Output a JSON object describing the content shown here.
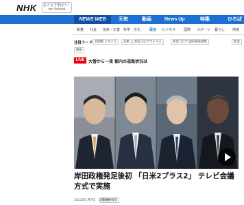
{
  "header": {
    "logo": "NHK",
    "home_link": {
      "line1": "おうちで学ぼう！",
      "line2": "for School"
    }
  },
  "nav": {
    "items": [
      "NEWS WEB",
      "天気",
      "動画",
      "News Up",
      "特集",
      "ひろば"
    ],
    "colors": {
      "bar": "#1d6fd1",
      "brand": "#1250a8"
    }
  },
  "categories": [
    "新着",
    "社会",
    "気象・災害",
    "科学・文化",
    "政治",
    "ビジネス",
    "国際",
    "スポーツ",
    "暮らし",
    "地域"
  ],
  "active_category": "政治",
  "keywords": {
    "label": "注目ワード",
    "row1": [
      "北朝鮮 ミサイル",
      "気象",
      "新型コロナウイルス",
      "新型コロナ 国内感染者数",
      "新型"
    ],
    "row2": [
      "動画"
    ]
  },
  "live": {
    "badge": "LIVE",
    "text": "大雪から一夜 都内の道路状況は"
  },
  "article": {
    "headline": "岸田政権発足後初 「日米2プラス2」 テレビ会議方式で実施",
    "date": "2022年1月7日　8時59分",
    "tag": "北朝鮮情勢"
  },
  "icons": {
    "play": "play-icon"
  }
}
